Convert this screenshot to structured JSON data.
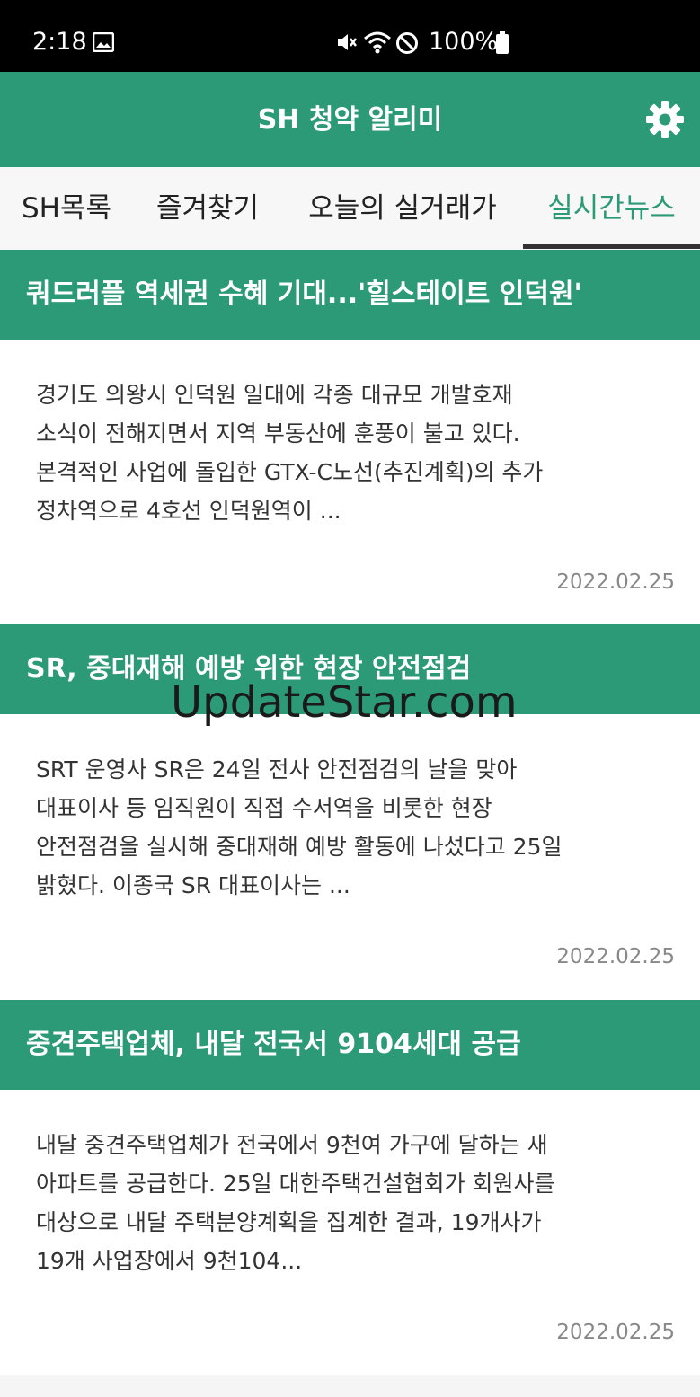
{
  "status_bar": {
    "time": "2:18",
    "battery": "100%",
    "icons": [
      "image-icon",
      "mute-icon",
      "wifi-icon",
      "dnd-icon",
      "battery-icon"
    ]
  },
  "app_bar": {
    "title": "SH 청약 알리미",
    "settings_icon": "gear-icon"
  },
  "tabs": [
    {
      "label": "SH목록"
    },
    {
      "label": "즐겨찾기"
    },
    {
      "label": "오늘의 실거래가"
    },
    {
      "label": "실시간뉴스",
      "active": true
    }
  ],
  "news": [
    {
      "headline": "쿼드러플 역세권 수혜 기대...'힐스테이트 인덕원'",
      "summary_lines": [
        "경기도 의왕시 인덕원 일대에 각종 대규모 개발호재",
        "소식이 전해지면서 지역 부동산에 훈풍이 불고 있다.",
        "본격적인 사업에 돌입한 GTX-C노선(추진계획)의 추가",
        "정차역으로 4호선 인덕원역이 ..."
      ],
      "date": "2022.02.25"
    },
    {
      "headline": "SR, 중대재해 예방 위한 현장 안전점검",
      "summary_lines": [
        "SRT 운영사 SR은 24일 전사 안전점검의 날을 맞아",
        "대표이사 등 임직원이 직접 수서역을 비롯한 현장",
        "안전점검을 실시해 중대재해 예방 활동에 나섰다고 25일",
        "밝혔다. 이종국 SR 대표이사는 ..."
      ],
      "date": "2022.02.25"
    },
    {
      "headline": "중견주택업체, 내달 전국서 9104세대 공급",
      "summary_lines": [
        "내달 중견주택업체가 전국에서 9천여 가구에 달하는 새",
        "아파트를 공급한다. 25일 대한주택건설협회가 회원사를",
        "대상으로 내달 주택분양계획을 집계한 결과, 19개사가",
        "19개 사업장에서 9천104..."
      ],
      "date": "2022.02.25"
    }
  ],
  "watermark": "UpdateStar.com",
  "colors": {
    "primary": "#2c9a77",
    "status_bar": "#000000",
    "tab_active_text": "#2c9a77",
    "date_text": "#888888"
  }
}
